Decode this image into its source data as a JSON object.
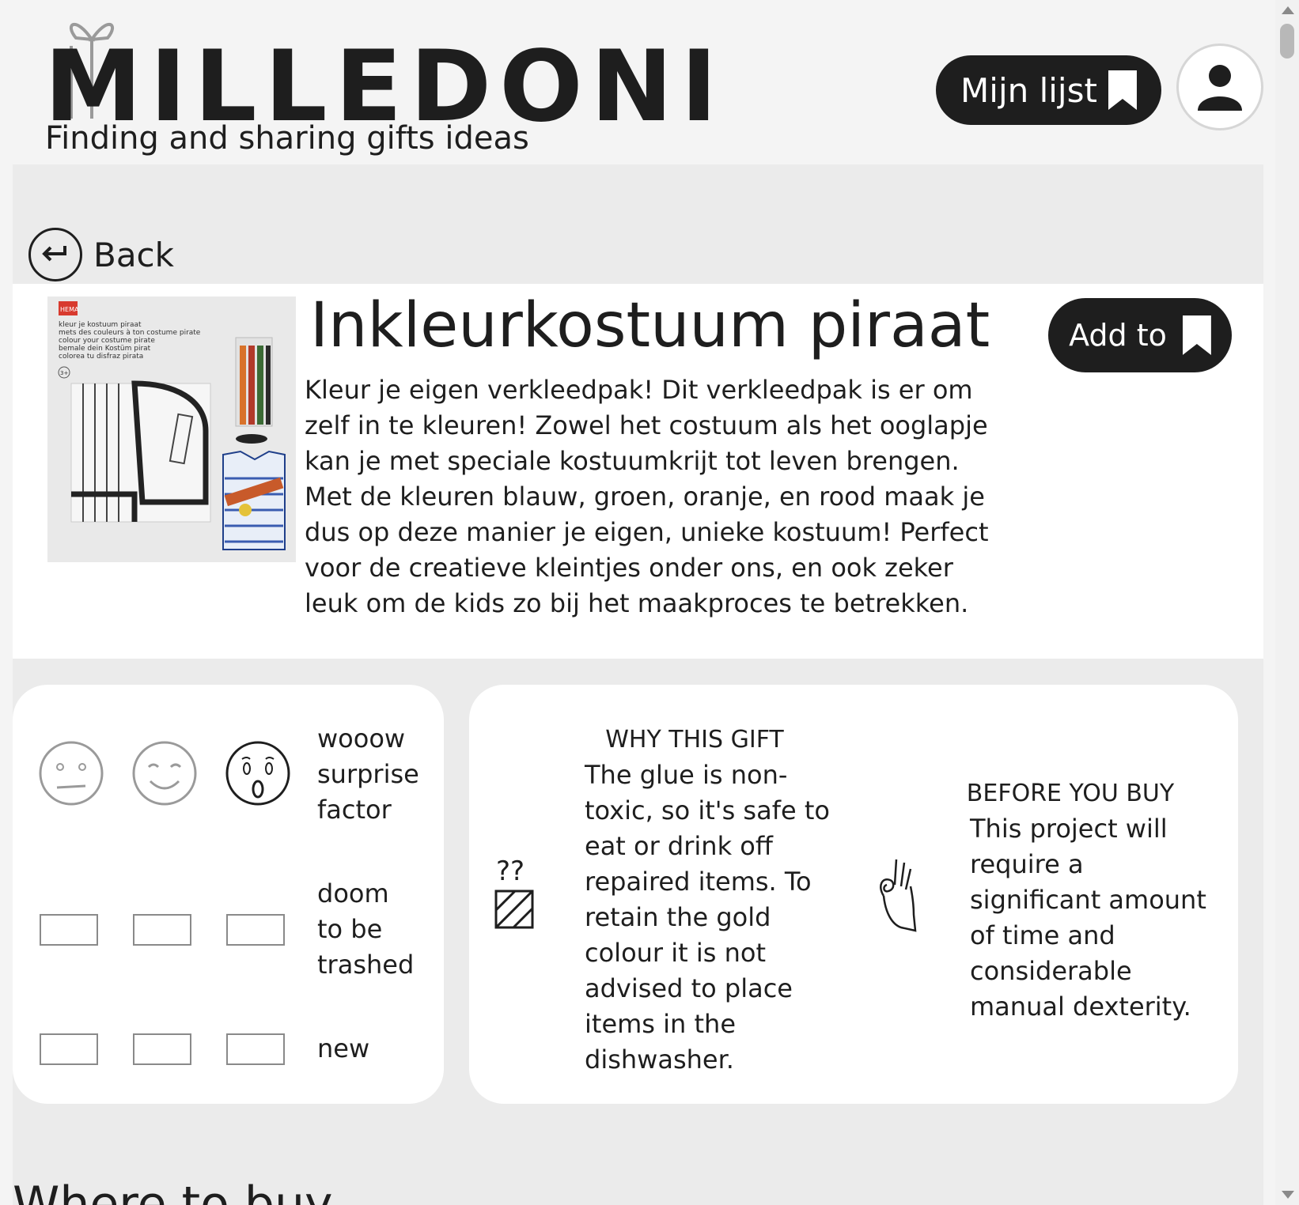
{
  "header": {
    "logo_text": "MILLEDONI",
    "tagline": "Finding and sharing gifts ideas",
    "my_list_label": "Mijn lijst"
  },
  "nav": {
    "back_label": "Back"
  },
  "product": {
    "title": "Inkleurkostuum piraat",
    "add_to_label": "Add to",
    "description": "Kleur je eigen verkleedpak! Dit verkleedpak is er om zelf in te kleuren! Zowel het costuum als het ooglapje kan je met speciale kostuumkrijt tot leven brengen. Met de kleuren blauw, groen, oranje, en rood maak je dus op deze manier je eigen, unieke kostuum! Perfect voor de creatieve kleintjes onder ons, en ook zeker leuk om de kids zo bij het maakproces te betrekken.",
    "image": {
      "brand": "HEMA",
      "lines": [
        "kleur je kostuum piraat",
        "mets des couleurs à ton costume pirate",
        "colour your costume pirate",
        "bemale dein Kostüm pirat",
        "colorea tu disfraz pirata"
      ],
      "age": "3+"
    }
  },
  "ratings": [
    {
      "label_lines": [
        "wooow",
        "surprise",
        "factor"
      ],
      "selected": 3
    },
    {
      "label_lines": [
        "doom",
        "to be",
        "trashed"
      ]
    },
    {
      "label_lines": [
        "new"
      ]
    }
  ],
  "why": {
    "heading": "WHY THIS GIFT",
    "body_lines": [
      "The glue is non-",
      "toxic, so it's safe to",
      "eat or drink off",
      "repaired items. To",
      "retain the gold",
      "colour it is not",
      "advised to place",
      "items in the",
      "dishwasher."
    ],
    "icon": "question-gift-icon"
  },
  "before": {
    "heading": "BEFORE YOU BUY",
    "body_lines": [
      "This project will",
      "require a",
      "significant amount",
      "of time and",
      "considerable",
      "manual dexterity."
    ],
    "icon": "ok-hand-icon"
  },
  "where_heading": "Where to buy",
  "colors": {
    "dark": "#1e1e1e",
    "band": "#ebebeb",
    "page": "#f4f4f4"
  }
}
